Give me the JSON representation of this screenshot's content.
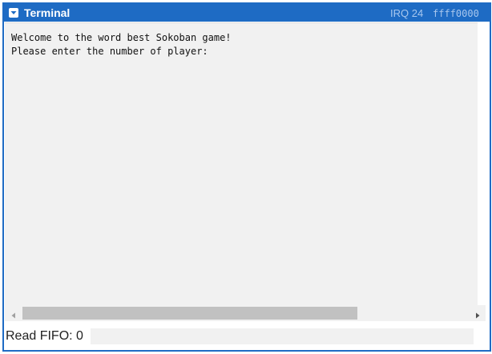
{
  "window": {
    "title": "Terminal",
    "irq": "IRQ 24",
    "address": "ffff0000",
    "accent_color": "#1e6bc4"
  },
  "console": {
    "lines": [
      "Welcome to the word best Sokoban game!",
      "Please enter the number of player:"
    ],
    "text": "Welcome to the word best Sokoban game!\nPlease enter the number of player:"
  },
  "icons": {
    "collapse": "chevron-down-icon",
    "scroll_left": "arrow-left-icon",
    "scroll_right": "arrow-right-icon"
  },
  "footer": {
    "fifo_label": "Read FIFO: 0",
    "fifo_value": ""
  }
}
